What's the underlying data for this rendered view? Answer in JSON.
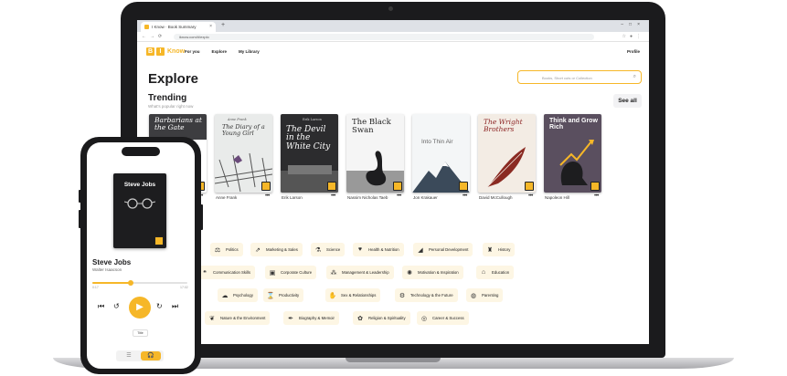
{
  "browser": {
    "tab_title": "I Know · Book Summary",
    "url": "iknow.com/#/explo"
  },
  "app": {
    "logo_b": "B",
    "logo_i": "I",
    "logo_text": "Know",
    "nav": [
      "For you",
      "Explore",
      "My Library"
    ],
    "profile": "Profile"
  },
  "explore": {
    "title": "Explore",
    "search_placeholder": "Books, Short cuts or Collection",
    "trending_title": "Trending",
    "trending_sub": "What's popular right now",
    "see_all": "See all"
  },
  "books": [
    {
      "title": "Barbarians at the Gate",
      "author": "",
      "bg": "#ffffff"
    },
    {
      "title": "The Diary of a Young Girl",
      "pre": "Anne Frank",
      "author": "Anne Frank",
      "bg": "#e9ebea"
    },
    {
      "title": "The Devil in the White City",
      "pre": "Erik Larson",
      "author": "Erik Larson",
      "bg": "#2c2c2e"
    },
    {
      "title": "The Black Swan",
      "author": "Nassim Nicholas Taeb",
      "bg": "#f5f5f5"
    },
    {
      "title": "Into Thin Air",
      "author": "Jon Krakauer",
      "bg": "#f4f6f7"
    },
    {
      "title": "The Wright Brothers",
      "author": "David McCullough",
      "bg": "#f3ece4"
    },
    {
      "title": "Think and Grow Rich",
      "author": "Napoleon Hill",
      "bg": "#5a4f5f"
    }
  ],
  "categories": [
    {
      "label": "Politics",
      "icon": "politics-icon",
      "glyph": "⚖"
    },
    {
      "label": "Marketing & Sales",
      "icon": "chart-icon",
      "glyph": "📈"
    },
    {
      "label": "Science",
      "icon": "flask-icon",
      "glyph": "⚗"
    },
    {
      "label": "Health & Nutrition",
      "icon": "heart-icon",
      "glyph": "♥"
    },
    {
      "label": "Personal Development",
      "icon": "growth-icon",
      "glyph": "◢"
    },
    {
      "label": "History",
      "icon": "trophy-icon",
      "glyph": "🏆"
    },
    {
      "label": "Communication Skills",
      "icon": "chat-icon",
      "glyph": "💬"
    },
    {
      "label": "Corporate Culture",
      "icon": "briefcase-icon",
      "glyph": "💼"
    },
    {
      "label": "Management & Leadership",
      "icon": "network-icon",
      "glyph": "⚙"
    },
    {
      "label": "Motivation & Inspiration",
      "icon": "lightbulb-icon",
      "glyph": "💡"
    },
    {
      "label": "Education",
      "icon": "graduation-icon",
      "glyph": "🎓"
    },
    {
      "label": "Psychology",
      "icon": "brain-icon",
      "glyph": "☁"
    },
    {
      "label": "Productivity",
      "icon": "hourglass-icon",
      "glyph": "⌛"
    },
    {
      "label": "Sex & Relationships",
      "icon": "hands-icon",
      "glyph": "✋"
    },
    {
      "label": "Technology & the Future",
      "icon": "cog-icon",
      "glyph": "⚙"
    },
    {
      "label": "Parenting",
      "icon": "pacifier-icon",
      "glyph": "◍"
    },
    {
      "label": "Nature & the Environment",
      "icon": "leaf-icon",
      "glyph": "❦"
    },
    {
      "label": "Biography & Memoir",
      "icon": "quill-icon",
      "glyph": "✒"
    },
    {
      "label": "Religion & Spirituality",
      "icon": "lotus-icon",
      "glyph": "✿"
    },
    {
      "label": "Career & Success",
      "icon": "target-icon",
      "glyph": "◎"
    }
  ],
  "phone": {
    "cover_title": "Steve Jobs",
    "title": "Steve Jobs",
    "author": "Walter Isaacson",
    "progress": 0.4,
    "time_left": "0:17",
    "time_right": "17:02",
    "title_tag": "Title",
    "toggle_left": "☰",
    "toggle_right": "🎧"
  },
  "colors": {
    "accent": "#f6b728",
    "dark": "#1d1d1f"
  }
}
